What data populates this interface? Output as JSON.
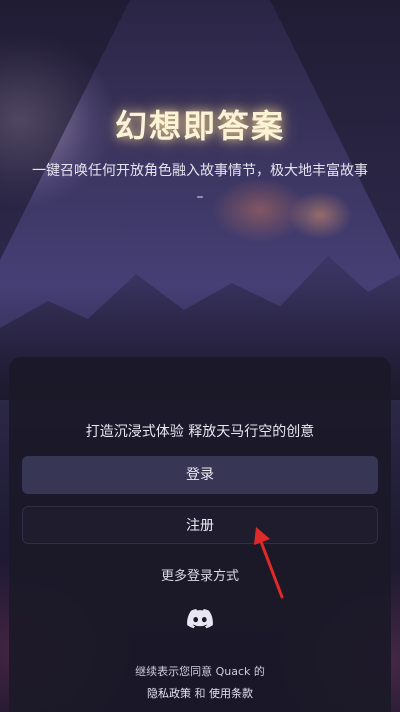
{
  "header": {
    "title": "幻想即答案",
    "subtitle": "一键召唤任何开放角色融入故事情节，极大地丰富故事",
    "subtitle_tail": "–"
  },
  "card": {
    "slogan": "打造沉浸式体验 释放天马行空的创意",
    "login_label": "登录",
    "register_label": "注册",
    "more_label": "更多登录方式",
    "social_icon": "discord-icon",
    "agree_text": "继续表示您同意 Quack 的",
    "privacy_label": "隐私政策",
    "and_text": "和",
    "terms_label": "使用条款"
  },
  "colors": {
    "accent_arrow": "#e02a2a",
    "login_bg": "#373655",
    "card_bg": "#1b1928",
    "title_glow": "#ffe196"
  }
}
